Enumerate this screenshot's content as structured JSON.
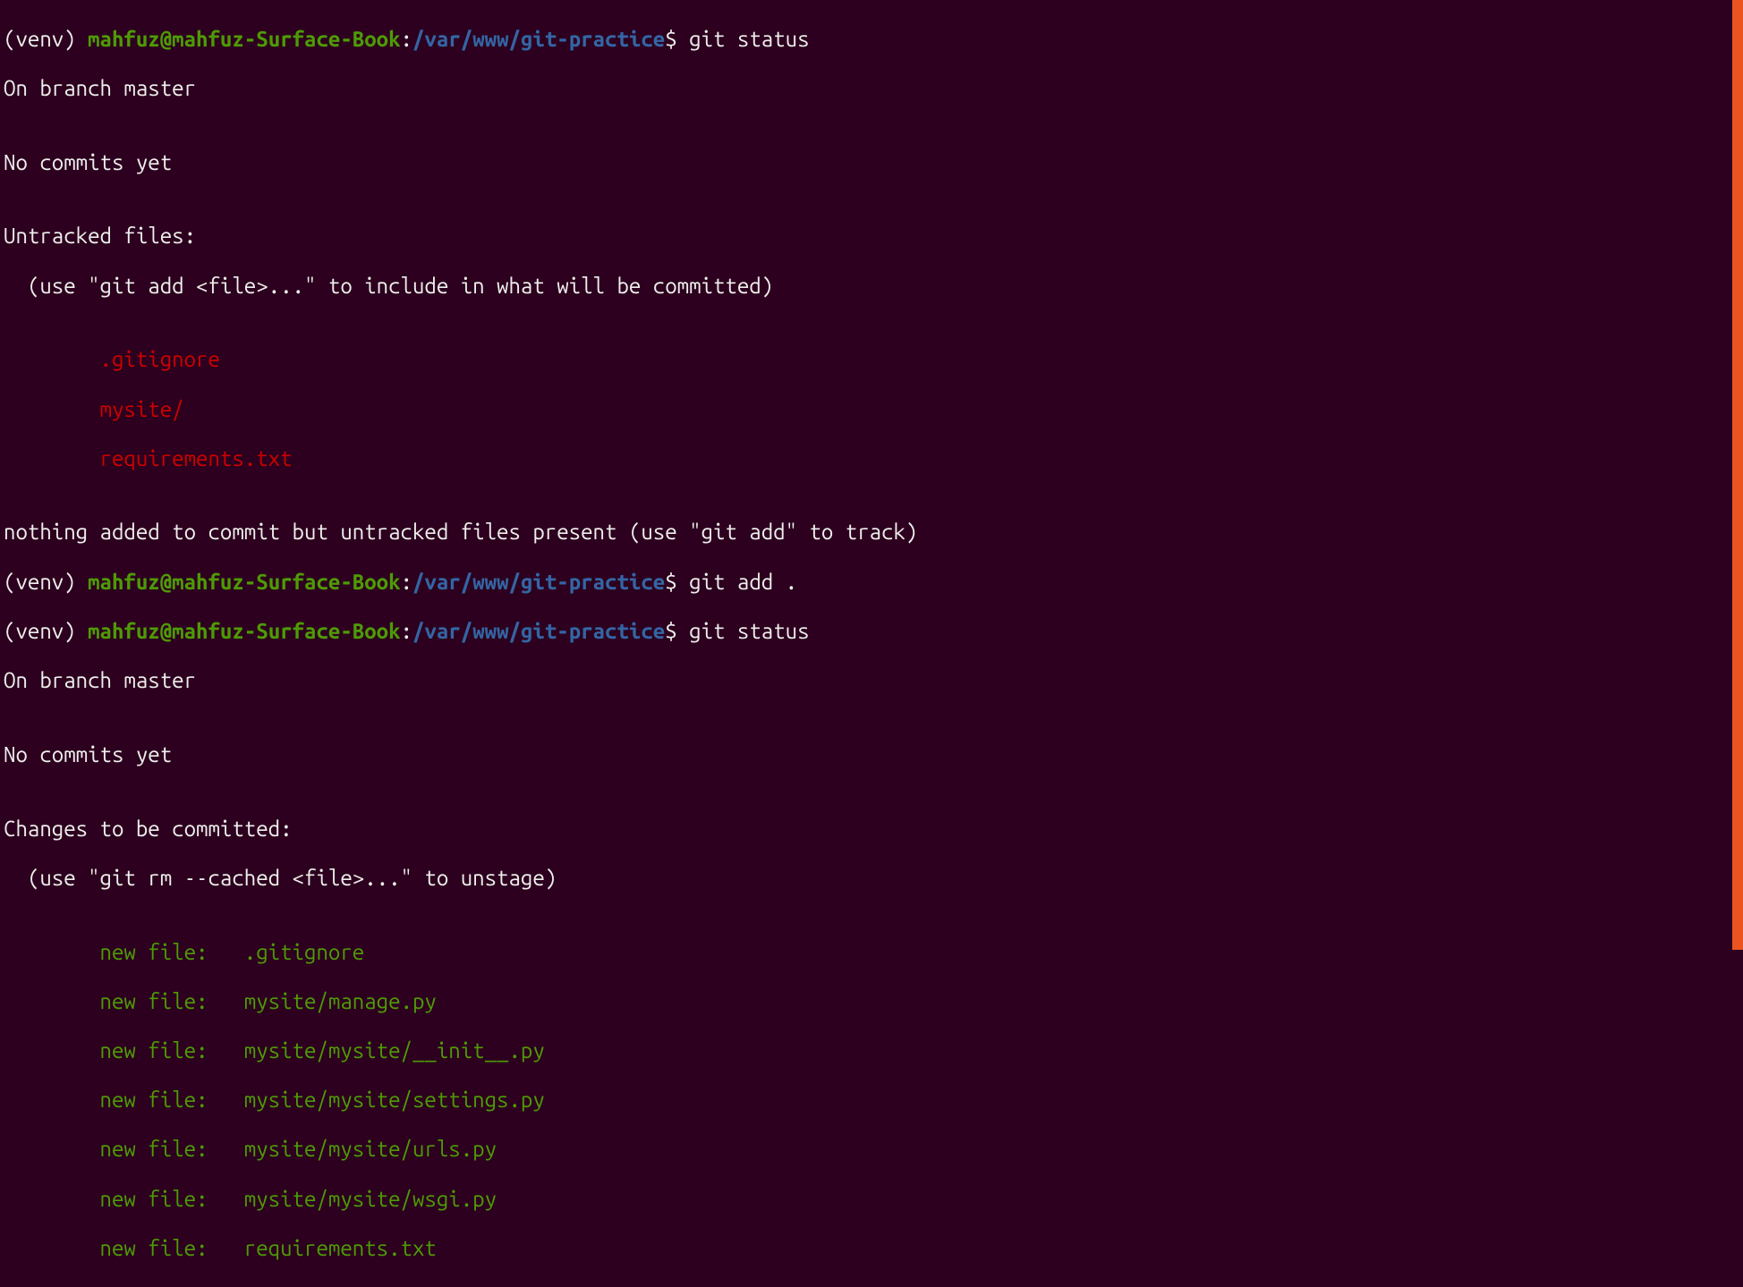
{
  "prompt": {
    "venv": "(venv) ",
    "user_host": "mahfuz@mahfuz-Surface-Book",
    "colon": ":",
    "path": "/var/www/git-practice",
    "dollar": "$ "
  },
  "session": {
    "cmd1": "git status",
    "out1_l1": "On branch master",
    "out1_l2": "",
    "out1_l3": "No commits yet",
    "out1_l4": "",
    "out1_l5": "Untracked files:",
    "out1_l6": "  (use \"git add <file>...\" to include in what will be committed)",
    "out1_l7": "",
    "untracked1": "        .gitignore",
    "untracked2": "        mysite/",
    "untracked3": "        requirements.txt",
    "out1_l8": "",
    "out1_l9": "nothing added to commit but untracked files present (use \"git add\" to track)",
    "cmd2": "git add .",
    "cmd3": "git status",
    "out3_l1": "On branch master",
    "out3_l2": "",
    "out3_l3": "No commits yet",
    "out3_l4": "",
    "out3_l5": "Changes to be committed:",
    "out3_l6": "  (use \"git rm --cached <file>...\" to unstage)",
    "out3_l7": "",
    "staged1": "        new file:   .gitignore",
    "staged2": "        new file:   mysite/manage.py",
    "staged3": "        new file:   mysite/mysite/__init__.py",
    "staged4": "        new file:   mysite/mysite/settings.py",
    "staged5": "        new file:   mysite/mysite/urls.py",
    "staged6": "        new file:   mysite/mysite/wsgi.py",
    "staged7": "        new file:   requirements.txt"
  }
}
